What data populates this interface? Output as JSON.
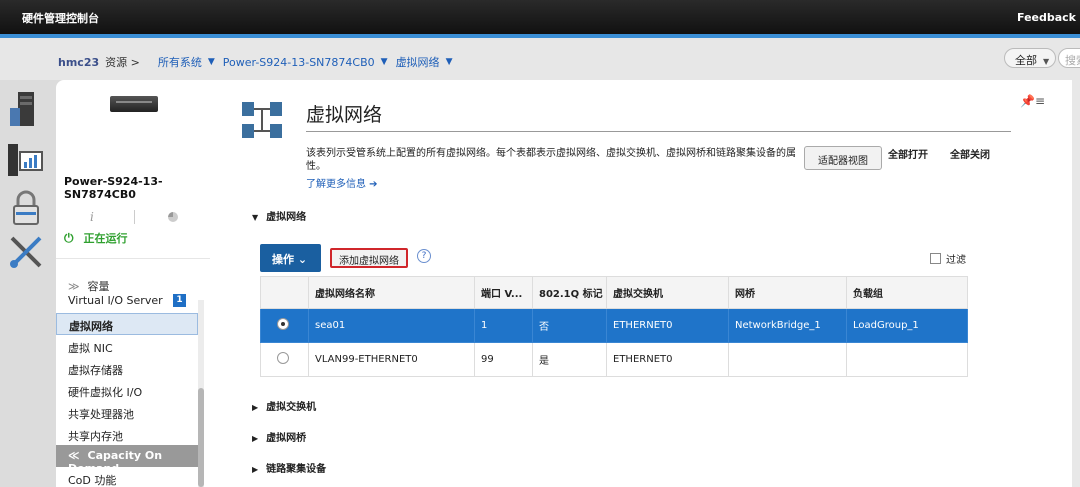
{
  "app": {
    "title": "硬件管理控制台",
    "feedback": "Feedback"
  },
  "breadcrumb": {
    "host": "hmc23",
    "resources": "资源 >",
    "all_systems": "所有系统",
    "system": "Power-S924-13-SN7874CB0",
    "current": "虚拟网络"
  },
  "search": {
    "scope": "全部",
    "placeholder": "搜索"
  },
  "rail": {
    "icons": [
      "server-tower-icon",
      "monitor-chart-icon",
      "padlock-icon",
      "tools-icon"
    ]
  },
  "side": {
    "system_name": "Power-S924-13-SN7874CB0",
    "status": "正在运行",
    "capacity": "容量",
    "items": [
      {
        "label": "Virtual I/O Server",
        "badge": "1"
      },
      {
        "label": "虚拟网络"
      },
      {
        "label": "虚拟 NIC"
      },
      {
        "label": "虚拟存储器"
      },
      {
        "label": "硬件虚拟化 I/O"
      },
      {
        "label": "共享处理器池"
      },
      {
        "label": "共享内存池"
      }
    ],
    "cod_header": "Capacity On Demand",
    "cod_item": "CoD 功能"
  },
  "main": {
    "title": "虚拟网络",
    "desc": "该表列示受管系统上配置的所有虚拟网络。每个表都表示虚拟网络、虚拟交换机、虚拟网桥和链路聚集设备的属性。",
    "learn_more": "了解更多信息 ➔",
    "adapter_view": "适配器视图",
    "expand_all": "全部打开",
    "collapse_all": "全部关闭",
    "sections": [
      "虚拟网络",
      "虚拟交换机",
      "虚拟网桥",
      "链路聚集设备"
    ],
    "ops": "操作",
    "add_network": "添加虚拟网络",
    "help": "?",
    "filter": "过滤",
    "table": {
      "headers": [
        "虚拟网络名称",
        "端口 V...",
        "802.1Q 标记",
        "虚拟交换机",
        "网桥",
        "负载组"
      ],
      "rows": [
        [
          "sea01",
          "1",
          "否",
          "ETHERNET0",
          "NetworkBridge_1",
          "LoadGroup_1"
        ],
        [
          "VLAN99-ETHERNET0",
          "99",
          "是",
          "ETHERNET0",
          "",
          ""
        ]
      ],
      "selected_row": 0
    }
  },
  "colors": {
    "accent": "#1f74c9",
    "primary_button": "#1a5fa0",
    "highlight_border": "#d0262b",
    "running": "#2fa02f"
  }
}
